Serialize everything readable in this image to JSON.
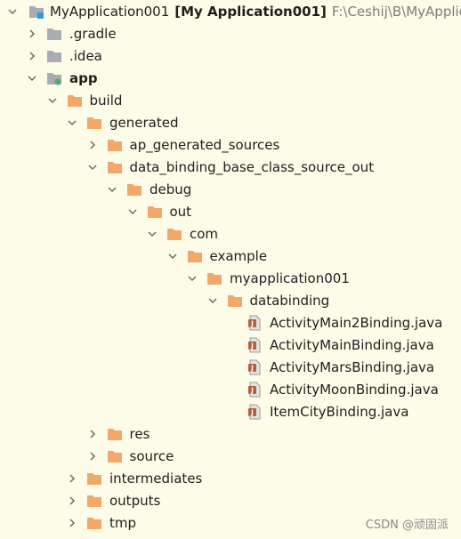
{
  "tree": [
    {
      "label": "MyApplication001",
      "suffix": "[My Application001]",
      "path": "F:\\Ceshij\\B\\MyApplicat",
      "depth": 0,
      "expanded": true,
      "icon": "module-icon",
      "bold": false
    },
    {
      "label": ".gradle",
      "depth": 1,
      "expanded": false,
      "icon": "folder-gray-icon"
    },
    {
      "label": ".idea",
      "depth": 1,
      "expanded": false,
      "icon": "folder-gray-icon"
    },
    {
      "label": "app",
      "depth": 1,
      "expanded": true,
      "icon": "module-folder-icon",
      "bold": true
    },
    {
      "label": "build",
      "depth": 2,
      "expanded": true,
      "icon": "folder-orange-icon"
    },
    {
      "label": "generated",
      "depth": 3,
      "expanded": true,
      "icon": "folder-orange-icon"
    },
    {
      "label": "ap_generated_sources",
      "depth": 4,
      "expanded": false,
      "icon": "folder-orange-icon"
    },
    {
      "label": "data_binding_base_class_source_out",
      "depth": 4,
      "expanded": true,
      "icon": "folder-orange-icon"
    },
    {
      "label": "debug",
      "depth": 5,
      "expanded": true,
      "icon": "folder-orange-icon"
    },
    {
      "label": "out",
      "depth": 6,
      "expanded": true,
      "icon": "folder-orange-icon"
    },
    {
      "label": "com",
      "depth": 7,
      "expanded": true,
      "icon": "folder-orange-icon"
    },
    {
      "label": "example",
      "depth": 8,
      "expanded": true,
      "icon": "folder-orange-icon"
    },
    {
      "label": "myapplication001",
      "depth": 9,
      "expanded": true,
      "icon": "folder-orange-icon"
    },
    {
      "label": "databinding",
      "depth": 10,
      "expanded": true,
      "icon": "folder-orange-icon"
    },
    {
      "label": "ActivityMain2Binding.java",
      "depth": 11,
      "leaf": true,
      "icon": "java-file-icon"
    },
    {
      "label": "ActivityMainBinding.java",
      "depth": 11,
      "leaf": true,
      "icon": "java-file-icon"
    },
    {
      "label": "ActivityMarsBinding.java",
      "depth": 11,
      "leaf": true,
      "icon": "java-file-icon"
    },
    {
      "label": "ActivityMoonBinding.java",
      "depth": 11,
      "leaf": true,
      "icon": "java-file-icon"
    },
    {
      "label": "ItemCityBinding.java",
      "depth": 11,
      "leaf": true,
      "icon": "java-file-icon"
    },
    {
      "label": "res",
      "depth": 4,
      "expanded": false,
      "icon": "folder-orange-icon"
    },
    {
      "label": "source",
      "depth": 4,
      "expanded": false,
      "icon": "folder-orange-icon"
    },
    {
      "label": "intermediates",
      "depth": 3,
      "expanded": false,
      "icon": "folder-orange-icon"
    },
    {
      "label": "outputs",
      "depth": 3,
      "expanded": false,
      "icon": "folder-orange-icon"
    },
    {
      "label": "tmp",
      "depth": 3,
      "expanded": false,
      "icon": "folder-orange-icon"
    }
  ],
  "watermark": "CSDN @顽固派",
  "colors": {
    "background": "#fcfce9",
    "folder_orange": "#f4a76b",
    "folder_gray": "#a8adb3",
    "module_blue": "#2c9de0",
    "module_green": "#59a869",
    "java_icon": "#bd5a3a"
  }
}
